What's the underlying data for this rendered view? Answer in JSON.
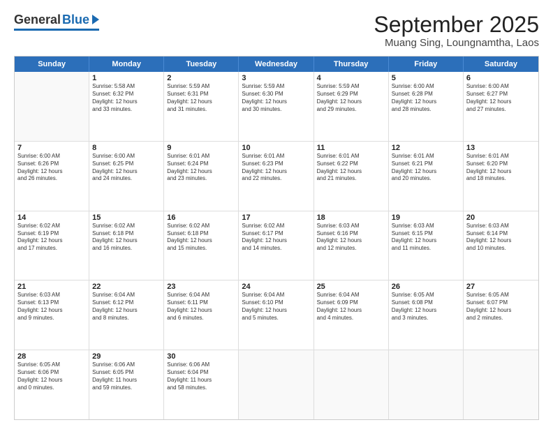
{
  "logo": {
    "general": "General",
    "blue": "Blue"
  },
  "title": "September 2025",
  "location": "Muang Sing, Loungnamtha, Laos",
  "header_days": [
    "Sunday",
    "Monday",
    "Tuesday",
    "Wednesday",
    "Thursday",
    "Friday",
    "Saturday"
  ],
  "rows": [
    [
      {
        "day": "",
        "lines": []
      },
      {
        "day": "1",
        "lines": [
          "Sunrise: 5:58 AM",
          "Sunset: 6:32 PM",
          "Daylight: 12 hours",
          "and 33 minutes."
        ]
      },
      {
        "day": "2",
        "lines": [
          "Sunrise: 5:59 AM",
          "Sunset: 6:31 PM",
          "Daylight: 12 hours",
          "and 31 minutes."
        ]
      },
      {
        "day": "3",
        "lines": [
          "Sunrise: 5:59 AM",
          "Sunset: 6:30 PM",
          "Daylight: 12 hours",
          "and 30 minutes."
        ]
      },
      {
        "day": "4",
        "lines": [
          "Sunrise: 5:59 AM",
          "Sunset: 6:29 PM",
          "Daylight: 12 hours",
          "and 29 minutes."
        ]
      },
      {
        "day": "5",
        "lines": [
          "Sunrise: 6:00 AM",
          "Sunset: 6:28 PM",
          "Daylight: 12 hours",
          "and 28 minutes."
        ]
      },
      {
        "day": "6",
        "lines": [
          "Sunrise: 6:00 AM",
          "Sunset: 6:27 PM",
          "Daylight: 12 hours",
          "and 27 minutes."
        ]
      }
    ],
    [
      {
        "day": "7",
        "lines": [
          "Sunrise: 6:00 AM",
          "Sunset: 6:26 PM",
          "Daylight: 12 hours",
          "and 26 minutes."
        ]
      },
      {
        "day": "8",
        "lines": [
          "Sunrise: 6:00 AM",
          "Sunset: 6:25 PM",
          "Daylight: 12 hours",
          "and 24 minutes."
        ]
      },
      {
        "day": "9",
        "lines": [
          "Sunrise: 6:01 AM",
          "Sunset: 6:24 PM",
          "Daylight: 12 hours",
          "and 23 minutes."
        ]
      },
      {
        "day": "10",
        "lines": [
          "Sunrise: 6:01 AM",
          "Sunset: 6:23 PM",
          "Daylight: 12 hours",
          "and 22 minutes."
        ]
      },
      {
        "day": "11",
        "lines": [
          "Sunrise: 6:01 AM",
          "Sunset: 6:22 PM",
          "Daylight: 12 hours",
          "and 21 minutes."
        ]
      },
      {
        "day": "12",
        "lines": [
          "Sunrise: 6:01 AM",
          "Sunset: 6:21 PM",
          "Daylight: 12 hours",
          "and 20 minutes."
        ]
      },
      {
        "day": "13",
        "lines": [
          "Sunrise: 6:01 AM",
          "Sunset: 6:20 PM",
          "Daylight: 12 hours",
          "and 18 minutes."
        ]
      }
    ],
    [
      {
        "day": "14",
        "lines": [
          "Sunrise: 6:02 AM",
          "Sunset: 6:19 PM",
          "Daylight: 12 hours",
          "and 17 minutes."
        ]
      },
      {
        "day": "15",
        "lines": [
          "Sunrise: 6:02 AM",
          "Sunset: 6:18 PM",
          "Daylight: 12 hours",
          "and 16 minutes."
        ]
      },
      {
        "day": "16",
        "lines": [
          "Sunrise: 6:02 AM",
          "Sunset: 6:18 PM",
          "Daylight: 12 hours",
          "and 15 minutes."
        ]
      },
      {
        "day": "17",
        "lines": [
          "Sunrise: 6:02 AM",
          "Sunset: 6:17 PM",
          "Daylight: 12 hours",
          "and 14 minutes."
        ]
      },
      {
        "day": "18",
        "lines": [
          "Sunrise: 6:03 AM",
          "Sunset: 6:16 PM",
          "Daylight: 12 hours",
          "and 12 minutes."
        ]
      },
      {
        "day": "19",
        "lines": [
          "Sunrise: 6:03 AM",
          "Sunset: 6:15 PM",
          "Daylight: 12 hours",
          "and 11 minutes."
        ]
      },
      {
        "day": "20",
        "lines": [
          "Sunrise: 6:03 AM",
          "Sunset: 6:14 PM",
          "Daylight: 12 hours",
          "and 10 minutes."
        ]
      }
    ],
    [
      {
        "day": "21",
        "lines": [
          "Sunrise: 6:03 AM",
          "Sunset: 6:13 PM",
          "Daylight: 12 hours",
          "and 9 minutes."
        ]
      },
      {
        "day": "22",
        "lines": [
          "Sunrise: 6:04 AM",
          "Sunset: 6:12 PM",
          "Daylight: 12 hours",
          "and 8 minutes."
        ]
      },
      {
        "day": "23",
        "lines": [
          "Sunrise: 6:04 AM",
          "Sunset: 6:11 PM",
          "Daylight: 12 hours",
          "and 6 minutes."
        ]
      },
      {
        "day": "24",
        "lines": [
          "Sunrise: 6:04 AM",
          "Sunset: 6:10 PM",
          "Daylight: 12 hours",
          "and 5 minutes."
        ]
      },
      {
        "day": "25",
        "lines": [
          "Sunrise: 6:04 AM",
          "Sunset: 6:09 PM",
          "Daylight: 12 hours",
          "and 4 minutes."
        ]
      },
      {
        "day": "26",
        "lines": [
          "Sunrise: 6:05 AM",
          "Sunset: 6:08 PM",
          "Daylight: 12 hours",
          "and 3 minutes."
        ]
      },
      {
        "day": "27",
        "lines": [
          "Sunrise: 6:05 AM",
          "Sunset: 6:07 PM",
          "Daylight: 12 hours",
          "and 2 minutes."
        ]
      }
    ],
    [
      {
        "day": "28",
        "lines": [
          "Sunrise: 6:05 AM",
          "Sunset: 6:06 PM",
          "Daylight: 12 hours",
          "and 0 minutes."
        ]
      },
      {
        "day": "29",
        "lines": [
          "Sunrise: 6:06 AM",
          "Sunset: 6:05 PM",
          "Daylight: 11 hours",
          "and 59 minutes."
        ]
      },
      {
        "day": "30",
        "lines": [
          "Sunrise: 6:06 AM",
          "Sunset: 6:04 PM",
          "Daylight: 11 hours",
          "and 58 minutes."
        ]
      },
      {
        "day": "",
        "lines": []
      },
      {
        "day": "",
        "lines": []
      },
      {
        "day": "",
        "lines": []
      },
      {
        "day": "",
        "lines": []
      }
    ]
  ]
}
